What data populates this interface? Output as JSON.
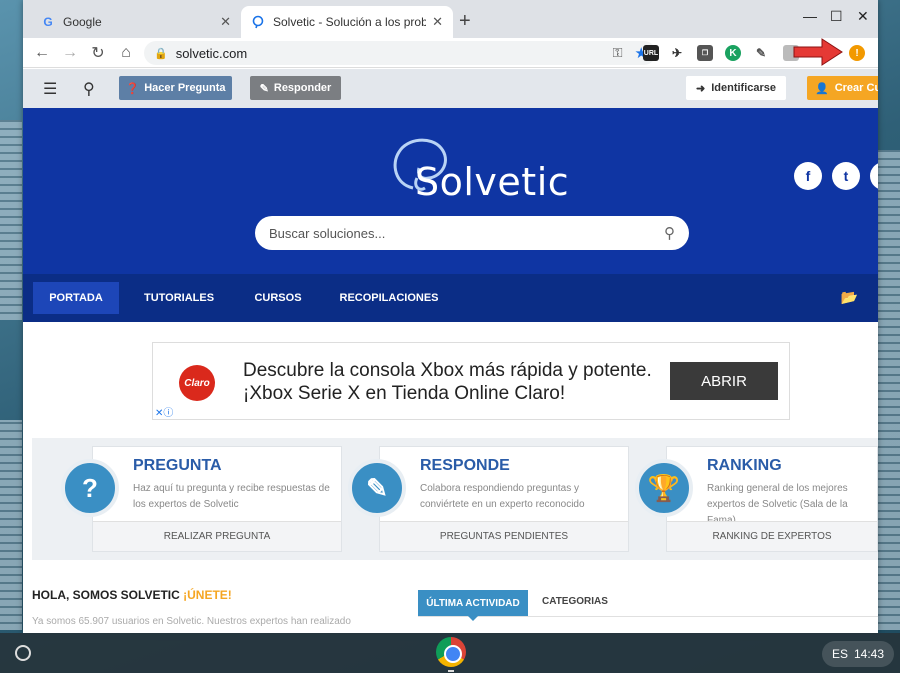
{
  "browser": {
    "tabs": [
      {
        "label": "Google",
        "favicon": "G"
      },
      {
        "label": "Solvetic - Solución a los problem",
        "favicon": "solvetic-icon"
      }
    ],
    "new_tab": "+",
    "url": "solvetic.com",
    "ext_uri": "URL",
    "ext_k": "K"
  },
  "site": {
    "header": {
      "ask_label": "Hacer Pregunta",
      "answer_label": "Responder",
      "login_label": "Identificarse",
      "signup_label": "Crear Cu"
    },
    "logo_text": "Solvetic",
    "search_placeholder": "Buscar soluciones...",
    "social": [
      "f",
      "t"
    ],
    "nav": [
      "PORTADA",
      "TUTORIALES",
      "CURSOS",
      "RECOPILACIONES"
    ],
    "ad": {
      "brand": "Claro",
      "text": "Descubre la consola Xbox más rápida y potente. ¡Xbox Serie X en Tienda Online Claro!",
      "button": "ABRIR",
      "choices": "✕ⓘ"
    },
    "cards": [
      {
        "title": "PREGUNTA",
        "desc": "Haz aquí tu pregunta y recibe respuestas de los expertos de Solvetic",
        "footer": "REALIZAR PREGUNTA",
        "icon": "?"
      },
      {
        "title": "RESPONDE",
        "desc": "Colabora respondiendo preguntas y conviértete en un experto reconocido",
        "footer": "PREGUNTAS PENDIENTES",
        "icon": "✎"
      },
      {
        "title": "RANKING",
        "desc": "Ranking general de los mejores expertos de Solvetic (Sala de la Fama)",
        "footer": "RANKING DE EXPERTOS",
        "icon": "🏆"
      }
    ],
    "hola": {
      "title": "HOLA, SOMOS SOLVETIC ",
      "join": "¡ÚNETE!",
      "sub": "Ya somos 65.907 usuarios en Solvetic. Nuestros expertos han realizado"
    },
    "activity_tabs": [
      "ÚLTIMA ACTIVIDAD",
      "CATEGORIAS"
    ]
  },
  "shelf": {
    "lang": "ES",
    "time": "14:43"
  },
  "colors": {
    "hero": "#0f35a3",
    "nav": "#0b2d86",
    "accent": "#3a8fc4",
    "orange": "#f5a623"
  }
}
